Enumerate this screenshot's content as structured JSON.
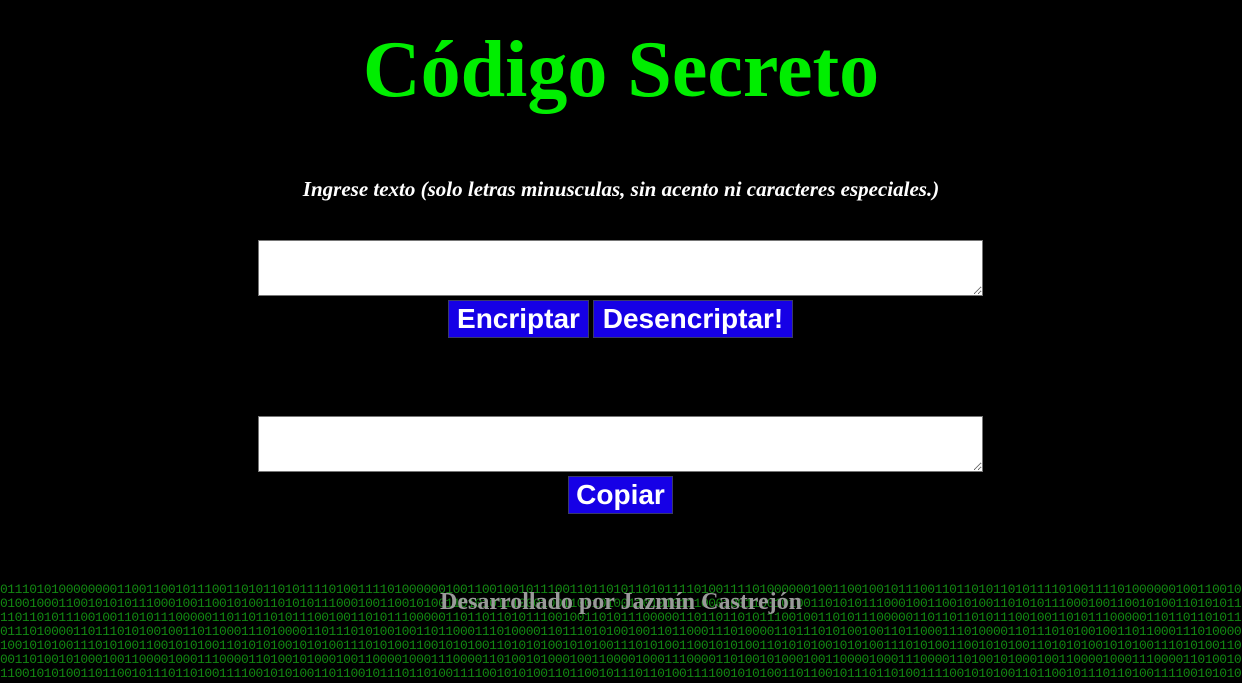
{
  "header": {
    "title": "Código Secreto",
    "instructions": "Ingrese texto (solo letras minusculas, sin acento ni caracteres especiales.)"
  },
  "input": {
    "value": ""
  },
  "actions": {
    "encrypt_label": "Encriptar",
    "decrypt_label": "Desencriptar!"
  },
  "output": {
    "value": "",
    "copy_label": "Copiar"
  },
  "footer": {
    "credit": "Desarrollado por Jazmín Castrejón"
  },
  "colors": {
    "background": "#000000",
    "title": "#00ee00",
    "button": "#1600e6",
    "button_text": "#ffffff",
    "binary_pattern": "#128812",
    "credit": "#9a9a9a"
  },
  "icons": {
    "background_pattern": "binary-code-pattern",
    "textarea_handle": "resize-handle-icon"
  }
}
